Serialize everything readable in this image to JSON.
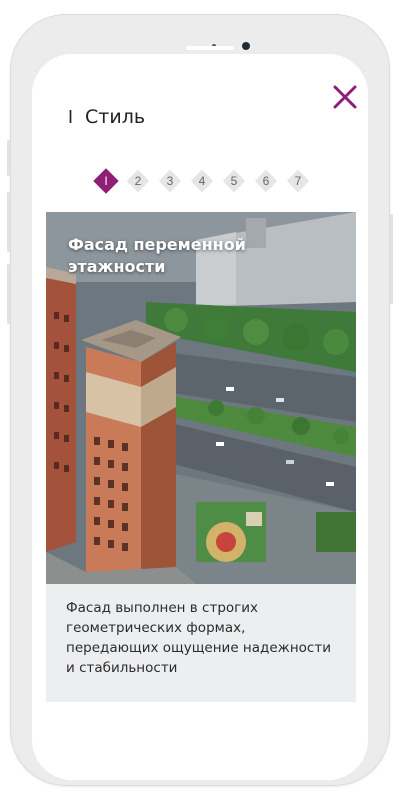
{
  "header": {
    "numeral": "I",
    "title": "Стиль"
  },
  "colors": {
    "accent": "#8e1e76",
    "step_inactive": "#e6e6e6"
  },
  "icons": {
    "close": "close-icon"
  },
  "steps": [
    {
      "label": "I",
      "active": true
    },
    {
      "label": "2",
      "active": false
    },
    {
      "label": "3",
      "active": false
    },
    {
      "label": "4",
      "active": false
    },
    {
      "label": "5",
      "active": false
    },
    {
      "label": "6",
      "active": false
    },
    {
      "label": "7",
      "active": false
    }
  ],
  "card": {
    "title": "Фасад переменной этажности",
    "caption": "Фасад выполнен в строгих геометрических формах, передающих ощущение надежности и стабильности"
  }
}
